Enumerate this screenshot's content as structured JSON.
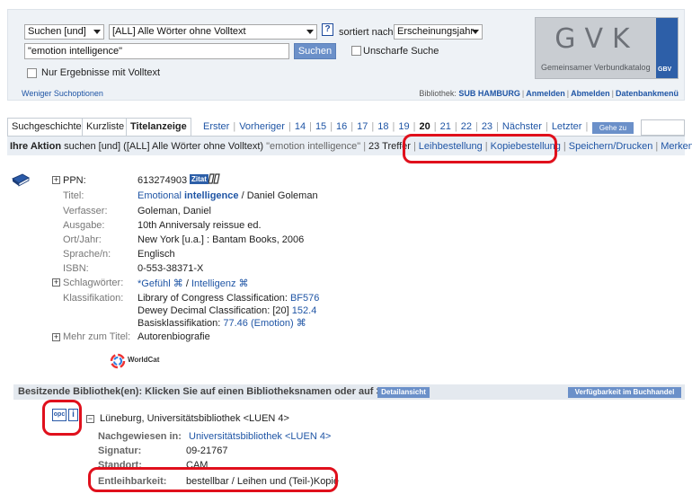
{
  "search": {
    "mode_select": "Suchen [und]",
    "field_select": "[ALL] Alle Wörter ohne Volltext",
    "sort_label": "sortiert nach",
    "sort_select": "Erscheinungsjahr",
    "query": "\"emotion intelligence\"",
    "search_button": "Suchen",
    "fuzzy_label": "Unscharfe Suche",
    "fulltext_label": "Nur Ergebnisse mit Volltext",
    "fewer_options": "Weniger Suchoptionen",
    "help": "?"
  },
  "logo": {
    "title": "GVK",
    "subtitle": "Gemeinsamer Verbundkatalog",
    "badge": "GBV"
  },
  "header_links": {
    "library_label": "Bibliothek:",
    "library": "SUB HAMBURG",
    "login": "Anmelden",
    "logout": "Abmelden",
    "db_menu": "Datenbankmenü"
  },
  "tabs": {
    "history": "Suchgeschichte",
    "short_list": "Kurzliste",
    "title_display": "Titelanzeige"
  },
  "pager": {
    "first": "Erster",
    "prev": "Vorheriger",
    "pages": [
      "14",
      "15",
      "16",
      "17",
      "18",
      "19",
      "20",
      "21",
      "22",
      "23"
    ],
    "current": "20",
    "next": "Nächster",
    "last": "Letzter",
    "goto": "Gehe zu"
  },
  "action": {
    "title": "Ihre Aktion",
    "text": "suchen [und] ([ALL] Alle Wörter ohne Volltext)",
    "query": "\"emotion intelligence\"",
    "hits": "23 Treffer",
    "loan_order": "Leihbestellung",
    "copy_order": "Kopiebestellung",
    "save_print": "Speichern/Drucken",
    "remember": "Merken"
  },
  "record": {
    "ppn_label": "PPN:",
    "ppn": "613274903",
    "zitat": "Zitat",
    "title_label": "Titel:",
    "title_pre": "Emotional",
    "title_bold": "intelligence",
    "title_post": "/ Daniel Goleman",
    "author_label": "Verfasser:",
    "author": "Goleman, Daniel",
    "edition_label": "Ausgabe:",
    "edition": "10th Anniversaly reissue ed.",
    "place_label": "Ort/Jahr:",
    "place": "New York [u.a.] : Bantam Books, 2006",
    "language_label": "Sprache/n:",
    "language": "Englisch",
    "isbn_label": "ISBN:",
    "isbn": "0-553-38371-X",
    "keywords_label": "Schlagwörter:",
    "keyword1": "*Gefühl",
    "keyword2": "Intelligenz",
    "class_label": "Klassifikation:",
    "class1_text": "Library of Congress Classification:",
    "class1_link": "BF576",
    "class2_text": "Dewey Decimal Classification: [20]",
    "class2_link": "152.4",
    "class3_text": "Basisklassifikation:",
    "class3_link": "77.46 (Emotion)",
    "more_label": "Mehr zum Titel:",
    "more_link": "Autorenbiografie",
    "worldcat": "WorldCat"
  },
  "holdings": {
    "bar_text": "Besitzende Bibliothek(en): Klicken Sie auf einen Bibliotheksnamen oder auf >",
    "detail_button": "Detailansicht",
    "availability_button": "Verfügbarkeit im Buchhandel",
    "opac_icon_text": "opc",
    "info_icon_text": "i",
    "library_name": "Lüneburg, Universitätsbibliothek <LUEN 4>",
    "proven_label": "Nachgewiesen in:",
    "proven_link": "Universitätsbibliothek <LUEN 4>",
    "signature_label": "Signatur:",
    "signature": "09-21767",
    "location_label": "Standort:",
    "location": "CAM",
    "lendability_label": "Entleihbarkeit:",
    "lendability": "bestellbar / Leihen und (Teil-)Kopie"
  },
  "colors": {
    "accent": "#1f55a5",
    "button": "#6b90c9",
    "highlight": "#e0101c"
  }
}
